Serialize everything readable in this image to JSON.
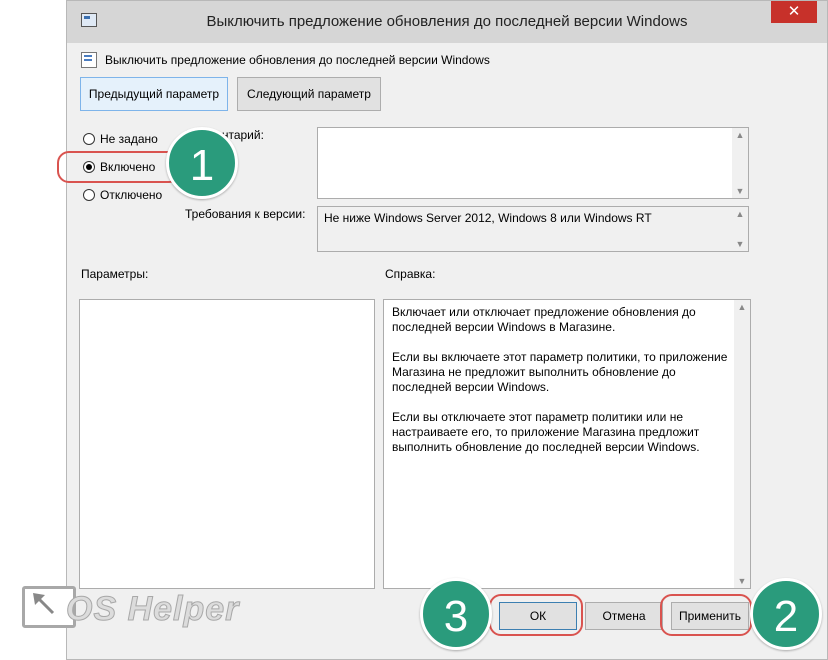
{
  "window": {
    "title": "Выключить предложение обновления до последней версии Windows",
    "close_label": "✕"
  },
  "header": {
    "text": "Выключить предложение обновления до последней версии Windows"
  },
  "nav": {
    "prev_label": "Предыдущий параметр",
    "next_label": "Следующий параметр"
  },
  "state": {
    "options": [
      {
        "label": "Не задано",
        "checked": false
      },
      {
        "label": "Включено",
        "checked": true
      },
      {
        "label": "Отключено",
        "checked": false
      }
    ]
  },
  "comment": {
    "label": "Комментарий:",
    "value": ""
  },
  "version": {
    "label": "Требования к версии:",
    "value": "Не ниже Windows Server 2012, Windows 8 или Windows RT"
  },
  "params": {
    "label": "Параметры:"
  },
  "help": {
    "label": "Справка:",
    "paragraphs": [
      "Включает или отключает предложение обновления до последней версии Windows в Магазине.",
      "Если вы включаете этот параметр политики, то приложение Магазина не предложит выполнить обновление до последней версии Windows.",
      "Если вы отключаете этот параметр политики или не настраиваете его, то приложение Магазина предложит выполнить обновление до последней версии Windows."
    ]
  },
  "buttons": {
    "ok": "ОК",
    "cancel": "Отмена",
    "apply": "Применить"
  },
  "annotations": {
    "m1": "1",
    "m2": "2",
    "m3": "3"
  },
  "logo": {
    "text": "OS Helper"
  },
  "colors": {
    "marker": "#2a9b7c",
    "highlight_ring": "#d9534f",
    "close": "#c7312a"
  }
}
